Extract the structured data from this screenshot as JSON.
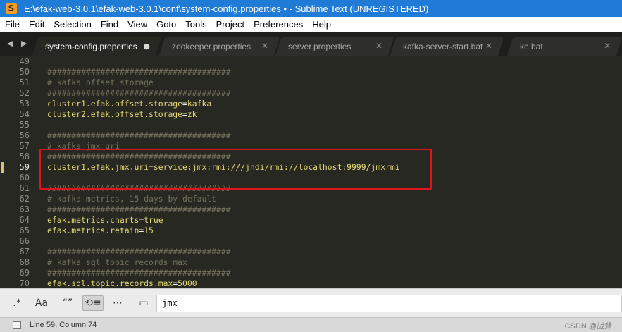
{
  "window": {
    "title": "E:\\efak-web-3.0.1\\efak-web-3.0.1\\conf\\system-config.properties • - Sublime Text (UNREGISTERED)"
  },
  "menu": [
    "File",
    "Edit",
    "Selection",
    "Find",
    "View",
    "Goto",
    "Tools",
    "Project",
    "Preferences",
    "Help"
  ],
  "tabs": [
    {
      "label": "system-config.properties",
      "active": true,
      "close": "●"
    },
    {
      "label": "zookeeper.properties",
      "active": false,
      "close": "✕"
    },
    {
      "label": "server.properties",
      "active": false,
      "close": "✕"
    },
    {
      "label": "kafka-server-start.bat",
      "active": false,
      "close": "✕"
    },
    {
      "label": "ke.bat",
      "active": false,
      "close": "✕"
    }
  ],
  "tab_nav": "◀ ▶",
  "editor": {
    "current_line": 59,
    "lines": [
      {
        "no": "49",
        "kind": "blank",
        "text": ""
      },
      {
        "no": "50",
        "kind": "comment",
        "text": "######################################"
      },
      {
        "no": "51",
        "kind": "comment",
        "text": "# kafka offset storage"
      },
      {
        "no": "52",
        "kind": "comment",
        "text": "######################################"
      },
      {
        "no": "53",
        "kind": "kv",
        "key": "cluster1.efak.offset.storage",
        "value": "kafka"
      },
      {
        "no": "54",
        "kind": "kv",
        "key": "cluster2.efak.offset.storage",
        "value": "zk"
      },
      {
        "no": "55",
        "kind": "blank",
        "text": ""
      },
      {
        "no": "56",
        "kind": "comment",
        "text": "######################################"
      },
      {
        "no": "57",
        "kind": "comment",
        "text": "# kafka jmx uri"
      },
      {
        "no": "58",
        "kind": "comment",
        "text": "######################################"
      },
      {
        "no": "59",
        "kind": "kv",
        "key": "cluster1.efak.jmx.uri",
        "value": "service:jmx:rmi:///jndi/rmi://localhost:9999/jmxrmi"
      },
      {
        "no": "60",
        "kind": "blank",
        "text": ""
      },
      {
        "no": "61",
        "kind": "comment",
        "text": "######################################"
      },
      {
        "no": "62",
        "kind": "comment",
        "text": "# kafka metrics, 15 days by default"
      },
      {
        "no": "63",
        "kind": "comment",
        "text": "######################################"
      },
      {
        "no": "64",
        "kind": "kv",
        "key": "efak.metrics.charts",
        "value": "true"
      },
      {
        "no": "65",
        "kind": "kv",
        "key": "efak.metrics.retain",
        "value": "15"
      },
      {
        "no": "66",
        "kind": "blank",
        "text": ""
      },
      {
        "no": "67",
        "kind": "comment",
        "text": "######################################"
      },
      {
        "no": "68",
        "kind": "comment",
        "text": "# kafka sql topic records max"
      },
      {
        "no": "69",
        "kind": "comment",
        "text": "######################################"
      },
      {
        "no": "70",
        "kind": "kv",
        "key": "efak.sql.topic.records.max",
        "value": "5000"
      }
    ]
  },
  "find": {
    "options": [
      {
        "label": ".*",
        "icon": "regex-icon",
        "on": false
      },
      {
        "label": "Aa",
        "icon": "case-sensitive-icon",
        "on": false
      },
      {
        "label": "“”",
        "icon": "whole-word-icon",
        "on": false
      },
      {
        "label": "⟲≡",
        "icon": "wrap-icon",
        "on": true
      },
      {
        "label": "⋯",
        "icon": "in-selection-icon",
        "on": false
      },
      {
        "label": "▭",
        "icon": "highlight-matches-icon",
        "on": false
      }
    ],
    "query": "jmx"
  },
  "status": {
    "text": "Line 59, Column 74"
  },
  "watermark": "CSDN @战斧",
  "colors": {
    "accent_title": "#1f7bd6",
    "editor_bg": "#272822",
    "comment": "#75715e",
    "string": "#e6db74",
    "annotation_box": "#e0141b"
  }
}
